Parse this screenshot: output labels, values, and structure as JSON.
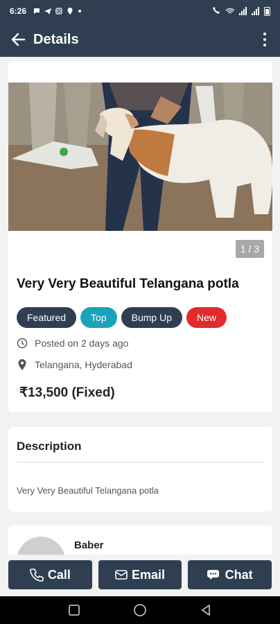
{
  "status_bar": {
    "time": "6:26"
  },
  "app_bar": {
    "title": "Details"
  },
  "listing": {
    "image_counter": "1 / 3",
    "title": "Very Very Beautiful Telangana potla",
    "badges": [
      {
        "label": "Featured",
        "color": "#2f3f51"
      },
      {
        "label": "Top",
        "color": "#1aa3b8"
      },
      {
        "label": "Bump Up",
        "color": "#2f3f51"
      },
      {
        "label": "New",
        "color": "#e32b2b"
      }
    ],
    "posted": "Posted on 2 days ago",
    "location": "Telangana, Hyderabad",
    "price": "₹13,500 (Fixed)"
  },
  "description": {
    "heading": "Description",
    "text": "Very Very Beautiful Telangana potla"
  },
  "seller": {
    "name": "Baber"
  },
  "actions": {
    "call": "Call",
    "email": "Email",
    "chat": "Chat"
  },
  "colors": {
    "primary": "#2f3f51",
    "accent": "#1aa3b8",
    "new": "#e32b2b"
  }
}
